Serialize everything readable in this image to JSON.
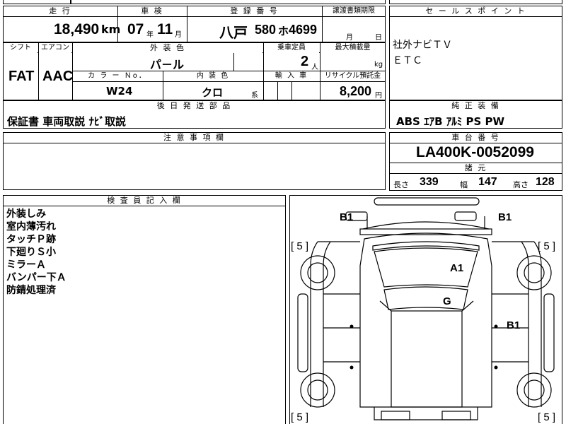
{
  "top": {
    "hdr_mileage": "走 行",
    "hdr_inspection": "車 検",
    "hdr_reg": "登 録 番 号",
    "hdr_transfer": "譲渡書類期限",
    "mileage": "18,490",
    "mileage_unit": "km",
    "insp_year": "07",
    "insp_year_unit": "年",
    "insp_month": "11",
    "insp_month_unit": "月",
    "reg_area": "八戸",
    "reg_class": "580",
    "reg_kana": "ホ",
    "reg_num": "4699",
    "transfer_month": "月",
    "transfer_day": "日"
  },
  "row2": {
    "hdr_shift": "シフト",
    "hdr_ac": "エアコン",
    "hdr_color": "外 装 色",
    "hdr_capacity": "乗車定員",
    "hdr_load": "最大積載量",
    "shift": "FAT",
    "ac": "AAC",
    "color": "パ－ル",
    "capacity": "2",
    "capacity_unit": "人",
    "load_unit": "kg",
    "hdr_colorno": "カ ラ ー Ｎo．",
    "hdr_interior": "内 装 色",
    "hdr_import": "輸 入 車",
    "hdr_recycle": "リサイクル預託金",
    "color_no": "W24",
    "interior": "クロ",
    "interior_unit": "系",
    "recycle": "8,200",
    "recycle_unit": "円"
  },
  "sales": {
    "hdr": "セ ー ル ス ポ イ ン ト",
    "line1": "社外ナビＴＶ",
    "line2": "ＥＴＣ"
  },
  "later": {
    "hdr": "後 日 発 送 部 品",
    "content": "保証書  車両取説  ﾅﾋﾞ取説"
  },
  "equipment": {
    "hdr": "純 正 装 備",
    "content": "ABS  ｴｱB  ｱﾙﾐ  PS  PW"
  },
  "caution": {
    "hdr": "注 意 事 項 欄"
  },
  "chassis": {
    "hdr": "車 台 番 号",
    "number": "LA400K-0052099",
    "specs_hdr": "諸 元",
    "len_label": "長さ",
    "len": "339",
    "width_label": "幅",
    "width": "147",
    "height_label": "高さ",
    "height": "128"
  },
  "inspector": {
    "hdr": "検 査 員 記 入 欄",
    "notes": [
      "外装しみ",
      "室内薄汚れ",
      "タッチＰ跡",
      "下廻りＳ小",
      "ミラーＡ",
      "バンパー下Ａ",
      "防錆処理済"
    ]
  },
  "diagram": {
    "b1_left": "B1",
    "b1_right": "B1",
    "a1": "A1",
    "g": "G",
    "b1_side": "B1",
    "tire_fl": "[ 5 ]",
    "tire_fr": "[ 5 ]",
    "tire_rl": "[ 5 ]",
    "tire_rr": "[ 5 ]"
  }
}
